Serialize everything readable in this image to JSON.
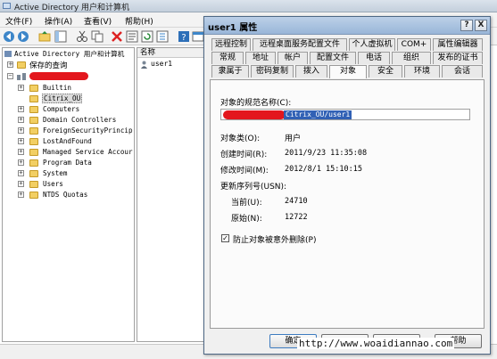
{
  "main_window": {
    "title": "Active Directory 用户和计算机",
    "menu": [
      "文件(F)",
      "操作(A)",
      "查看(V)",
      "帮助(H)"
    ]
  },
  "tree": {
    "root": "Active Directory 用户和计算机",
    "saved_queries": "保存的查询",
    "containers": [
      "Builtin",
      "Citrix_OU",
      "Computers",
      "Domain Controllers",
      "ForeignSecurityPrincip",
      "LostAndFound",
      "Managed Service Accour",
      "Program Data",
      "System",
      "Users",
      "NTDS Quotas"
    ]
  },
  "list": {
    "header": "名称",
    "items": [
      "user1"
    ]
  },
  "dialog": {
    "title": "user1 属性",
    "help_glyph": "?",
    "close_glyph": "X",
    "tabs_row1": [
      "远程控制",
      "远程桌面服务配置文件",
      "个人虚拟机",
      "COM+",
      "属性编辑器"
    ],
    "tabs_row2": [
      "常规",
      "地址",
      "帐户",
      "配置文件",
      "电话",
      "组织",
      "发布的证书"
    ],
    "tabs_row3": [
      "隶属于",
      "密码复制",
      "拨入",
      "对象",
      "安全",
      "环境",
      "会话"
    ],
    "object": {
      "canonical_label": "对象的规范名称(C):",
      "canonical_value": "Citrix_OU/user1",
      "class_label": "对象类(O):",
      "class_value": "用户",
      "created_label": "创建时间(R):",
      "created_value": "2011/9/23 11:35:08",
      "modified_label": "修改时间(M):",
      "modified_value": "2012/8/1 15:10:15",
      "usn_label": "更新序列号(USN):",
      "current_label": "当前(U):",
      "current_value": "24710",
      "original_label": "原始(N):",
      "original_value": "12722",
      "protect_label": "防止对象被意外删除(P)",
      "protect_checked": true
    },
    "buttons": {
      "ok": "确定",
      "help": "帮助"
    }
  },
  "watermark": "http://www.woaidiannao.com",
  "colors": {
    "redaction": "#e3171d",
    "selection": "#3161b5",
    "titlebar": "#99b6d8"
  }
}
